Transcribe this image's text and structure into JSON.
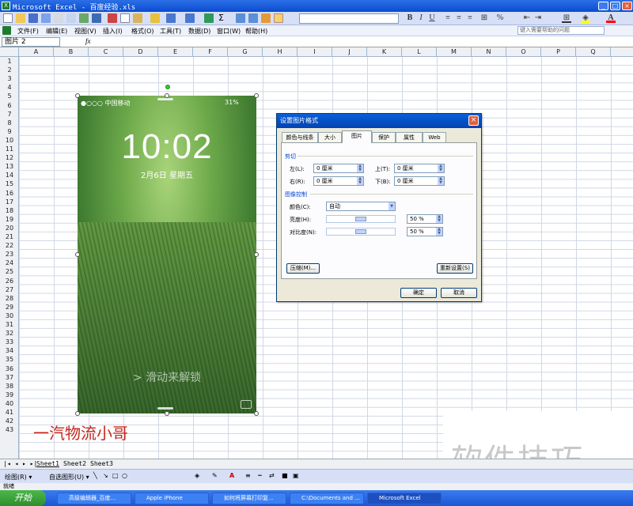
{
  "window": {
    "title": "Microsoft Excel - 百度经验.xls"
  },
  "menubar": {
    "items": [
      "文件(F)",
      "编辑(E)",
      "视图(V)",
      "插入(I)",
      "格式(O)",
      "工具(T)",
      "数据(D)",
      "窗口(W)",
      "帮助(H)"
    ],
    "help_placeholder": "键入需要帮助的问题"
  },
  "formula": {
    "namebox": "图片 2",
    "fx": "fx"
  },
  "columns": [
    "A",
    "B",
    "C",
    "D",
    "E",
    "F",
    "G",
    "H",
    "I",
    "J",
    "K",
    "L",
    "M",
    "N",
    "O",
    "P",
    "Q"
  ],
  "rows": [
    "1",
    "2",
    "3",
    "4",
    "5",
    "6",
    "7",
    "8",
    "9",
    "10",
    "11",
    "12",
    "13",
    "14",
    "15",
    "16",
    "17",
    "18",
    "19",
    "20",
    "21",
    "22",
    "23",
    "24",
    "25",
    "26",
    "27",
    "28",
    "29",
    "30",
    "31",
    "32",
    "33",
    "34",
    "35",
    "36",
    "37",
    "38",
    "39",
    "40",
    "41",
    "42",
    "43"
  ],
  "phone": {
    "carrier": "●○○○ 中国移动",
    "battery": "31%",
    "time": "10:02",
    "date": "2月6日 星期五",
    "unlock": "> 滑动来解锁"
  },
  "dialog": {
    "title": "设置图片格式",
    "tabs": [
      "颜色与线条",
      "大小",
      "图片",
      "保护",
      "属性",
      "Web"
    ],
    "crop_section": "剪切",
    "left_label": "左(L):",
    "left_value": "0 厘米",
    "right_label": "右(R):",
    "right_value": "0 厘米",
    "top_label": "上(T):",
    "top_value": "0 厘米",
    "bottom_label": "下(B):",
    "bottom_value": "0 厘米",
    "image_section": "图像控制",
    "color_label": "颜色(C):",
    "color_value": "自动",
    "brightness_label": "亮度(H):",
    "brightness_value": "50 %",
    "contrast_label": "对比度(N):",
    "contrast_value": "50 %",
    "compress_button": "压缩(M)...",
    "reset_button": "重新设置(S)",
    "ok_button": "确定",
    "cancel_button": "取消"
  },
  "sheets": [
    "Sheet1",
    "Sheet2",
    "Sheet3"
  ],
  "drawbar": {
    "draw_label": "绘图(R) ▾",
    "autoshape_label": "自选图形(U) ▾"
  },
  "status": "就绪",
  "taskbar": {
    "start": "开始",
    "tasks": [
      "高级编辑器_百度...",
      "Apple iPhone",
      "如何将屏幕打印复...",
      "C:\\Documents and ...",
      "Microsoft Excel"
    ]
  },
  "overlay": {
    "author": "一汽物流小哥",
    "site": "软件技巧"
  }
}
